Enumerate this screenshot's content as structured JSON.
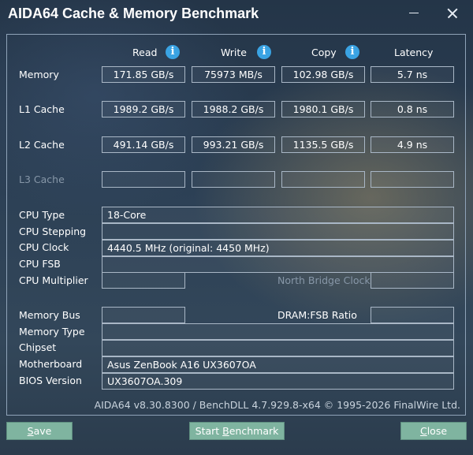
{
  "window": {
    "title": "AIDA64 Cache & Memory Benchmark"
  },
  "columns": {
    "read": "Read",
    "write": "Write",
    "copy": "Copy",
    "latency": "Latency"
  },
  "rows": {
    "memory": {
      "label": "Memory",
      "read": "171.85 GB/s",
      "write": "75973 MB/s",
      "copy": "102.98 GB/s",
      "latency": "5.7 ns"
    },
    "l1": {
      "label": "L1 Cache",
      "read": "1989.2 GB/s",
      "write": "1988.2 GB/s",
      "copy": "1980.1 GB/s",
      "latency": "0.8 ns"
    },
    "l2": {
      "label": "L2 Cache",
      "read": "491.14 GB/s",
      "write": "993.21 GB/s",
      "copy": "1135.5 GB/s",
      "latency": "4.9 ns"
    },
    "l3": {
      "label": "L3 Cache",
      "read": "",
      "write": "",
      "copy": "",
      "latency": ""
    }
  },
  "info": {
    "cpu_type": {
      "label": "CPU Type",
      "value": "18-Core"
    },
    "cpu_stepping": {
      "label": "CPU Stepping",
      "value": ""
    },
    "cpu_clock": {
      "label": "CPU Clock",
      "value": "4440.5 MHz  (original: 4450 MHz)"
    },
    "cpu_fsb": {
      "label": "CPU FSB",
      "value": ""
    },
    "cpu_multiplier": {
      "label": "CPU Multiplier",
      "value": ""
    },
    "north_bridge_clock": {
      "label": "North Bridge Clock",
      "value": ""
    },
    "memory_bus": {
      "label": "Memory Bus",
      "value": ""
    },
    "dram_fsb_ratio": {
      "label": "DRAM:FSB Ratio",
      "value": ""
    },
    "memory_type": {
      "label": "Memory Type",
      "value": ""
    },
    "chipset": {
      "label": "Chipset",
      "value": ""
    },
    "motherboard": {
      "label": "Motherboard",
      "value": "Asus ZenBook A16 UX3607OA"
    },
    "bios_version": {
      "label": "BIOS Version",
      "value": "UX3607OA.309"
    }
  },
  "footer": {
    "version": "AIDA64 v8.30.8300 / BenchDLL 4.7.929.8-x64 © 1995-2026 FinalWire Ltd."
  },
  "buttons": {
    "save": {
      "accel": "S",
      "rest": "ave"
    },
    "start": {
      "pre": "Start ",
      "accel": "B",
      "rest": "enchmark"
    },
    "close": {
      "accel": "C",
      "rest": "lose"
    }
  },
  "icons": {
    "info": "info-icon",
    "minimize": "minimize-icon",
    "close": "close-icon"
  },
  "colors": {
    "info_icon": "#3aa3e3",
    "button": "#7fb4a0"
  }
}
